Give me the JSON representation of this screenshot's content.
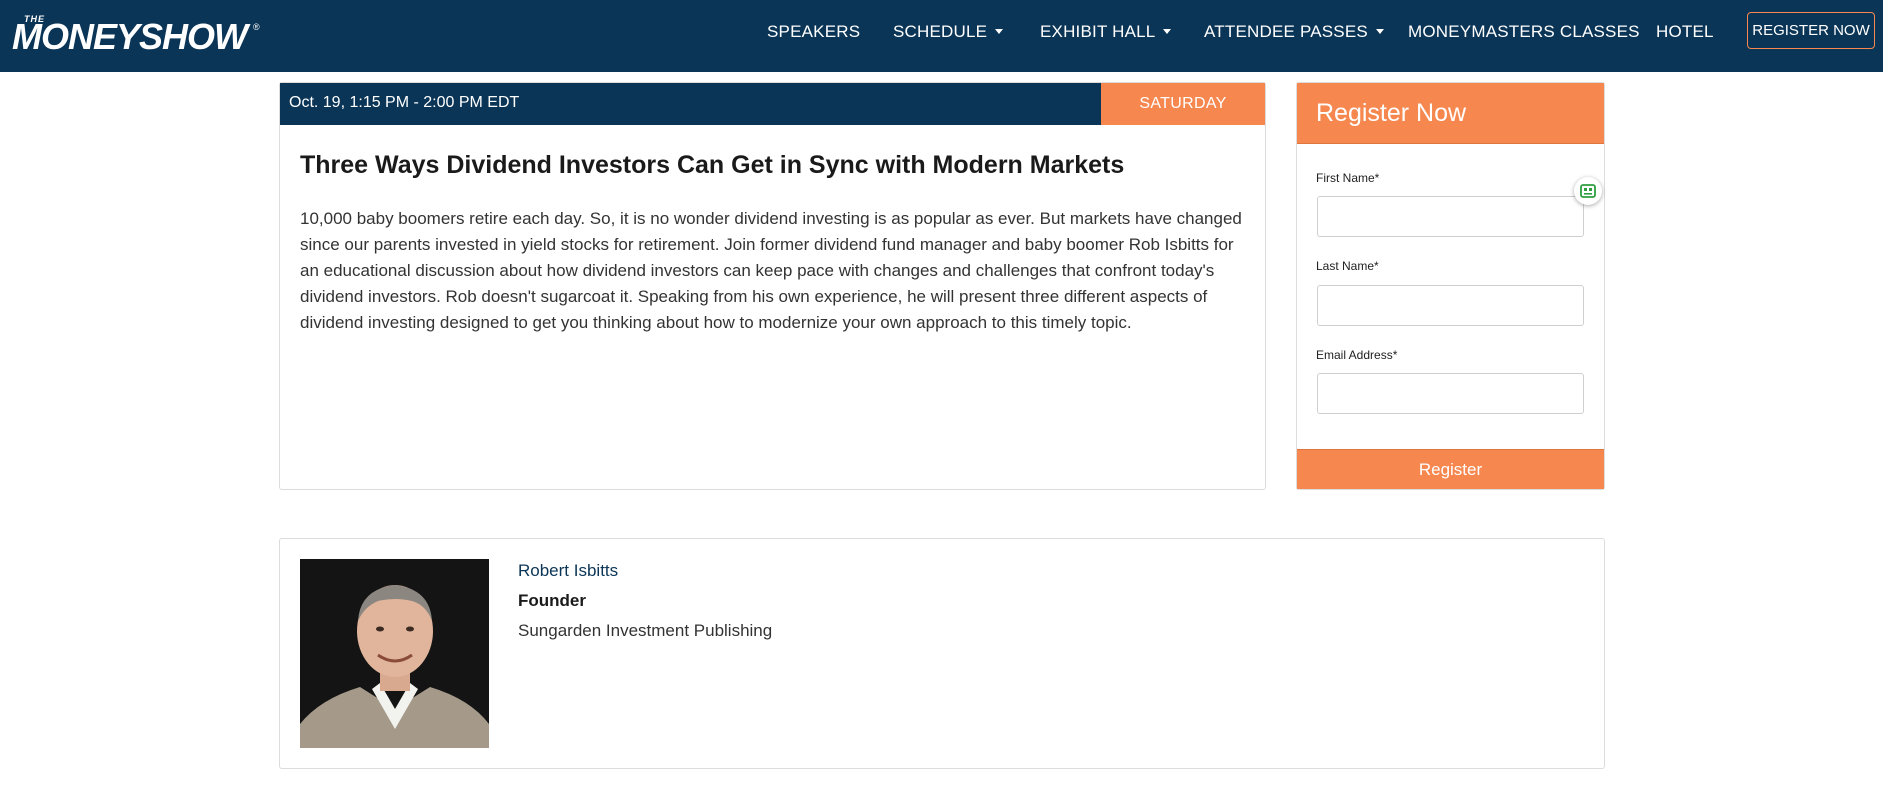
{
  "brand": {
    "logo_prefix": "THE",
    "logo_text": "MONEYSHOW",
    "logo_mark": "®"
  },
  "nav": {
    "items": [
      {
        "label": "SPEAKERS",
        "has_dropdown": false
      },
      {
        "label": "SCHEDULE",
        "has_dropdown": true
      },
      {
        "label": "EXHIBIT HALL",
        "has_dropdown": true
      },
      {
        "label": "ATTENDEE PASSES",
        "has_dropdown": true
      },
      {
        "label": "MONEYMASTERS CLASSES",
        "has_dropdown": false
      },
      {
        "label": "HOTEL",
        "has_dropdown": false
      }
    ],
    "register_label": "REGISTER NOW"
  },
  "session": {
    "time": "Oct. 19, 1:15 PM - 2:00 PM EDT",
    "day": "SATURDAY",
    "title": "Three Ways Dividend Investors Can Get in Sync with Modern Markets",
    "description": "10,000 baby boomers retire each day. So, it is no wonder dividend investing is as popular as ever. But markets have changed since our parents invested in yield stocks for retirement. Join former dividend fund manager and baby boomer Rob Isbitts for an educational discussion about how dividend investors can keep pace with changes and challenges that confront today's dividend investors. Rob doesn't sugarcoat it. Speaking from his own experience, he will present three different aspects of dividend investing designed to get you thinking about how to modernize your own approach to this timely topic."
  },
  "register_form": {
    "title": "Register Now",
    "first_name_label": "First Name*",
    "first_name_value": "",
    "last_name_label": "Last Name*",
    "last_name_value": "",
    "email_label": "Email Address*",
    "email_value": "",
    "submit_label": "Register",
    "autofill_icon": "contact-card-icon"
  },
  "speaker": {
    "name": "Robert Isbitts",
    "role": "Founder",
    "company": "Sungarden Investment Publishing",
    "photo_icon": "speaker-headshot"
  },
  "colors": {
    "navy": "#0b3556",
    "orange": "#f5874f",
    "autofill_green": "#2e9e3e"
  }
}
